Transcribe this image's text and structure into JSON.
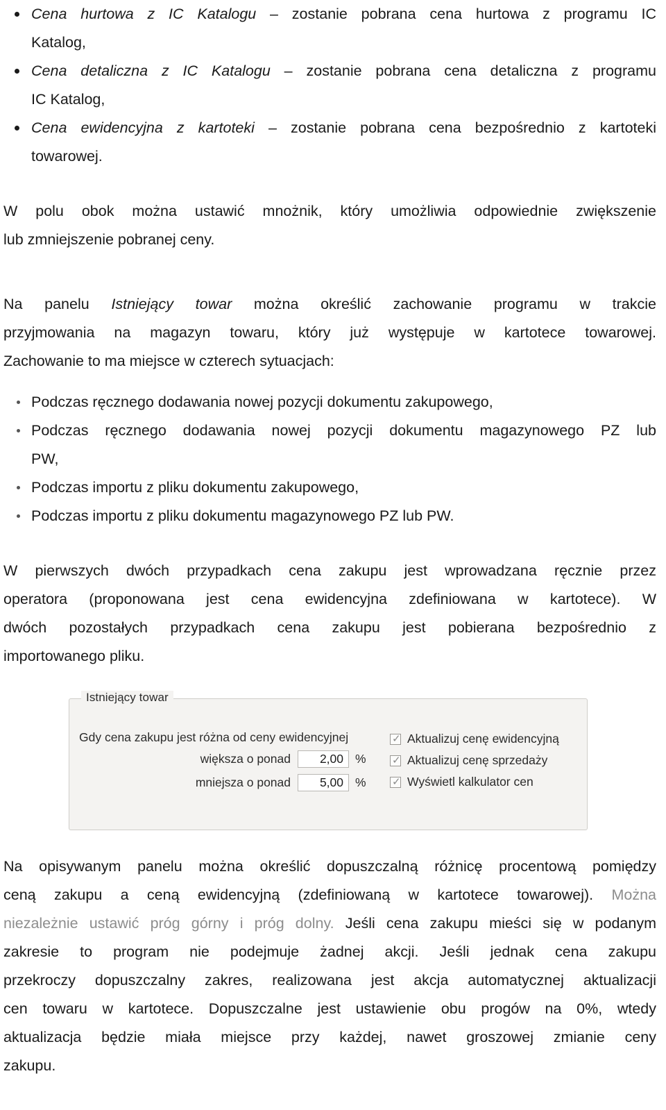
{
  "document": {
    "price_source_bullets": [
      {
        "emphasis": "Cena hurtowa z IC Katalogu",
        "rest_line1": " – zostanie pobrana cena hurtowa z programu IC",
        "line2": "Katalog,"
      },
      {
        "emphasis": "Cena detaliczna z IC Katalogu",
        "rest_line1": " – zostanie pobrana cena detaliczna z programu",
        "line2": "IC Katalog,"
      },
      {
        "emphasis": "Cena ewidencyjna z kartoteki",
        "rest_line1": " – zostanie pobrana cena bezpośrednio z kartoteki",
        "line2": "towarowej."
      }
    ],
    "paragraph_multiplier": {
      "line1": "W polu obok można ustawić mnożnik, który umożliwia  odpowiednie zwiększenie",
      "line2": "lub zmniejszenie pobranej ceny."
    },
    "paragraph_panel_intro": {
      "line1_pre": "Na panelu ",
      "line1_em": "Istniejący towar",
      "line1_post": " można określić zachowanie programu w trakcie",
      "line2": "przyjmowania na magazyn towaru, który już występuje w kartotece towarowej.",
      "line3": "Zachowanie to ma miejsce w czterech sytuacjach:"
    },
    "situation_bullets": [
      {
        "line1": "Podczas ręcznego dodawania nowej pozycji dokumentu zakupowego,",
        "line2": ""
      },
      {
        "line1": "Podczas ręcznego dodawania nowej pozycji dokumentu magazynowego PZ lub",
        "line2": "PW,"
      },
      {
        "line1": "Podczas importu z pliku dokumentu zakupowego,",
        "line2": ""
      },
      {
        "line1": "Podczas importu z pliku dokumentu magazynowego PZ lub PW.",
        "line2": ""
      }
    ],
    "paragraph_manual_vs_import": {
      "line1": "W pierwszych dwóch przypadkach cena zakupu jest wprowadzana ręcznie przez",
      "line2": "operatora (proponowana jest cena ewidencyjna zdefiniowana w kartotece). W",
      "line3": "dwóch pozostałych przypadkach cena zakupu jest pobierana bezpośrednio z",
      "line4": "importowanego pliku."
    },
    "paragraph_tolerance": {
      "line1": "Na opisywanym panelu można określić dopuszczalną różnicę procentową pomiędzy",
      "line2_dark": "ceną zakupu a ceną ewidencyjną (zdefiniowaną w kartotece towarowej). ",
      "line2_grey": "Można",
      "line3_grey": "niezależnie ustawić próg górny i próg dolny. ",
      "line3_dark": "Jeśli cena zakupu mieści się w podanym",
      "line4": "zakresie to program nie podejmuje żadnej akcji. Jeśli jednak cena zakupu",
      "line5": "przekroczy dopuszczalny zakres, realizowana jest akcja automatycznej aktualizacji",
      "line6": "cen towaru w kartotece. Dopuszczalne jest ustawienie obu progów na 0%, wtedy",
      "line7": "aktualizacja będzie miała miejsce przy każdej, nawet groszowej zmianie ceny",
      "line8": "zakupu."
    }
  },
  "panel": {
    "legend": "Istniejący towar",
    "condition_label": "Gdy cena zakupu jest różna od ceny ewidencyjnej",
    "rows": [
      {
        "label": "większa o ponad",
        "value": "2,00",
        "unit": "%"
      },
      {
        "label": "mniejsza o ponad",
        "value": "5,00",
        "unit": "%"
      }
    ],
    "checkboxes": [
      {
        "label": "Aktualizuj cenę ewidencyjną",
        "checked": true,
        "glyph": "✓"
      },
      {
        "label": "Aktualizuj cenę sprzedaży",
        "checked": true,
        "glyph": "✓"
      },
      {
        "label": "Wyświetl kalkulator cen",
        "checked": true,
        "glyph": "✓"
      }
    ]
  },
  "colors": {
    "text": "#1a1a1a",
    "muted_text": "#8d8d8d",
    "panel_bg": "#f4f3f1",
    "panel_border": "#cfcdc9",
    "field_bg": "#ffffff",
    "field_border": "#b9b7b3"
  }
}
